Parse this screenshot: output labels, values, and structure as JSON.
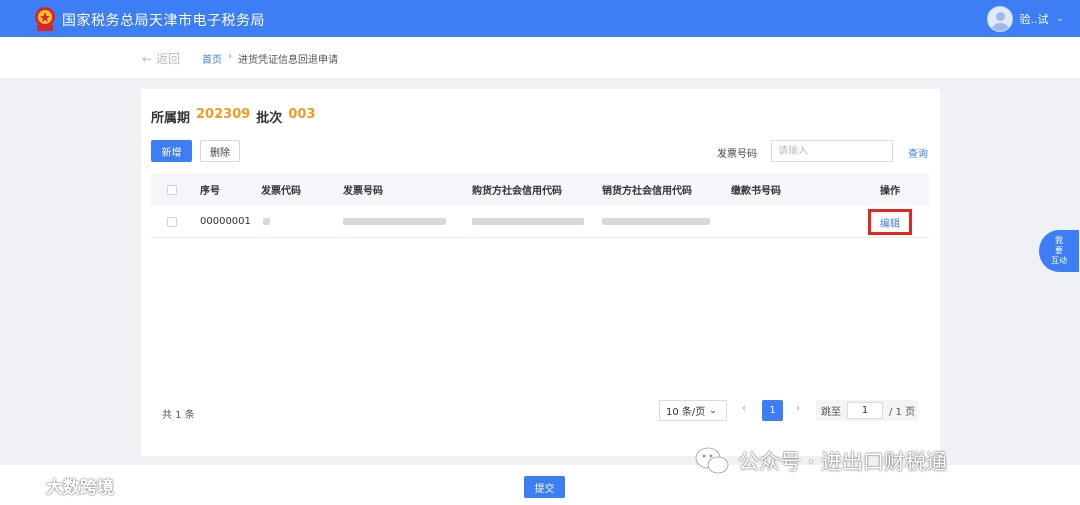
{
  "header": {
    "title": "国家税务总局天津市电子税务局",
    "user_name": "验..试"
  },
  "nav": {
    "back_label": "返回",
    "breadcrumb_home": "首页",
    "breadcrumb_sep": "›",
    "breadcrumb_current": "进货凭证信息回退申请"
  },
  "period": {
    "label": "所属期",
    "value": "202309",
    "batch_label": "批次",
    "batch_value": "003"
  },
  "toolbar": {
    "add_label": "新增",
    "delete_label": "删除",
    "search_label": "发票号码",
    "search_placeholder": "请输入",
    "query_label": "查询"
  },
  "table": {
    "columns": [
      "序号",
      "发票代码",
      "发票号码",
      "购货方社会信用代码",
      "销货方社会信用代码",
      "缴款书号码",
      "操作"
    ],
    "rows": [
      {
        "seq": "00000001",
        "action_label": "编辑"
      }
    ]
  },
  "pagination": {
    "total_text": "共 1 条",
    "page_size_label": "10 条/页",
    "current_page": "1",
    "jump_label": "跳至",
    "jump_value": "1",
    "page_total": "/ 1 页",
    "prev": "‹",
    "next": "›"
  },
  "footer": {
    "submit_label": "提交"
  },
  "watermarks": {
    "left": "大数跨境",
    "right": "公众号 · 进出口财税通"
  },
  "side_widget": {
    "text_line1": "我",
    "text_line2": "要",
    "text_line3": "互动"
  },
  "colors": {
    "primary": "#3d7df5",
    "accent_orange": "#f59a23",
    "highlight_red": "#e5271d"
  }
}
